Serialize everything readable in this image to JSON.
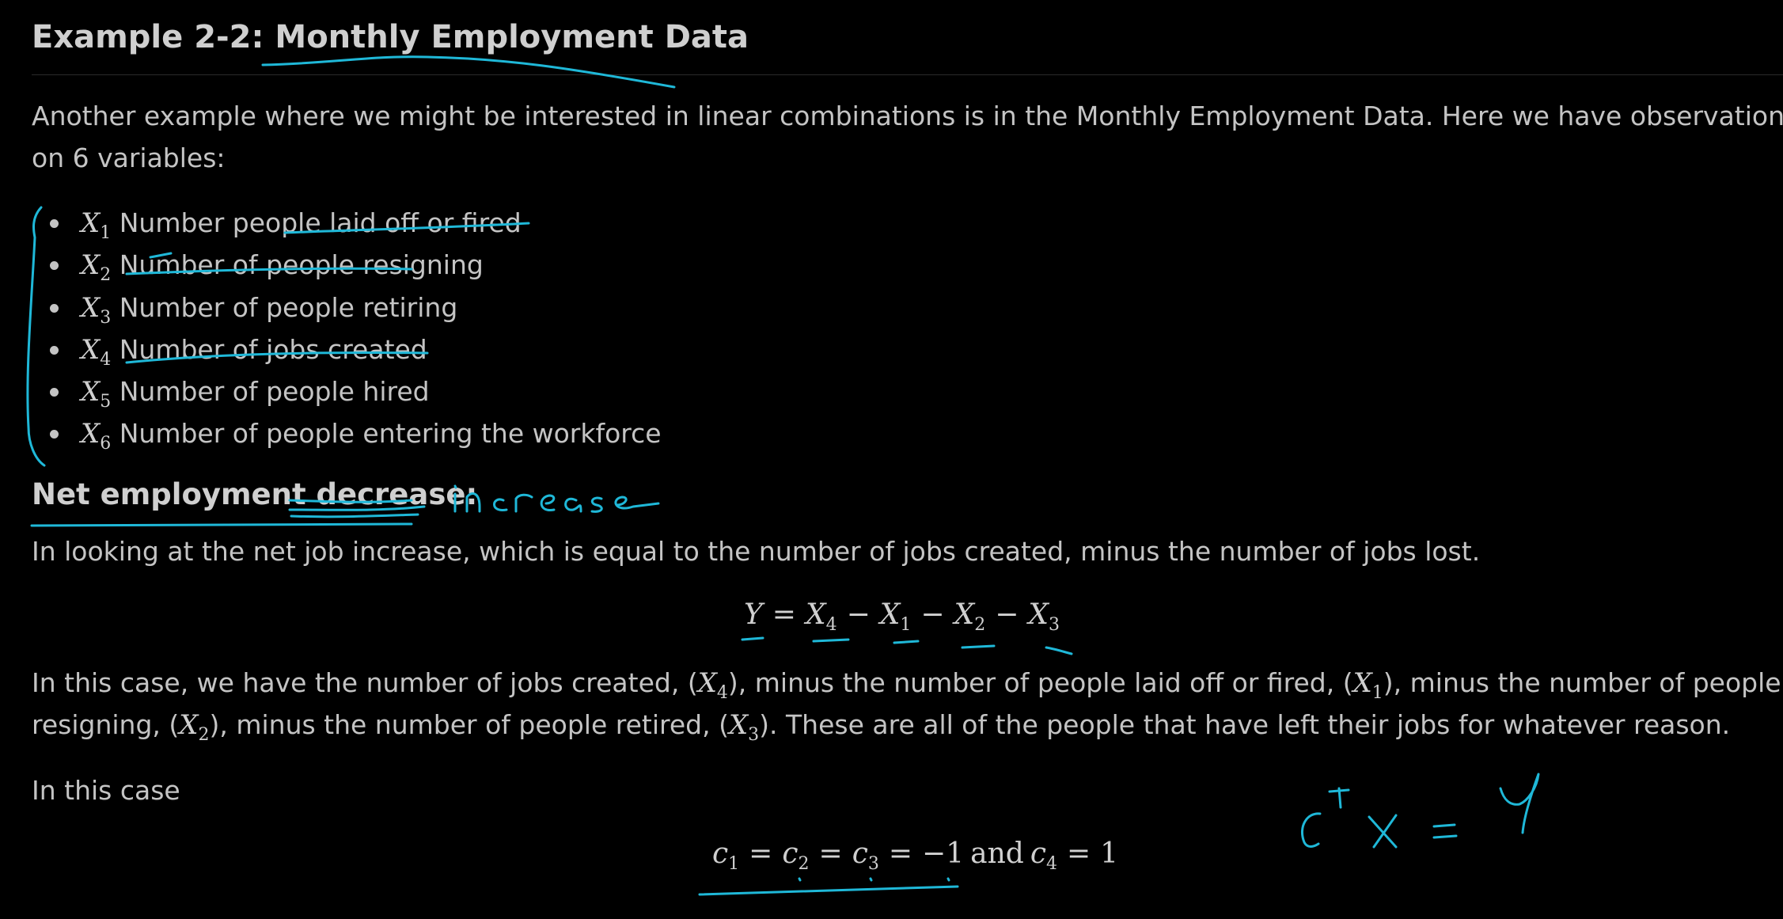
{
  "heading": "Example 2-2: Monthly Employment Data",
  "intro_line1": "Another example where we might be interested in linear combinations is in the Monthly Employment Data. Here we have observations",
  "intro_line2": "on 6 variables:",
  "variables": [
    {
      "symbol": "X",
      "sub": "1",
      "label": "Number people laid off or fired"
    },
    {
      "symbol": "X",
      "sub": "2",
      "label": "Number of people resigning"
    },
    {
      "symbol": "X",
      "sub": "3",
      "label": "Number of people retiring"
    },
    {
      "symbol": "X",
      "sub": "4",
      "label": "Number of jobs created"
    },
    {
      "symbol": "X",
      "sub": "5",
      "label": "Number of people hired"
    },
    {
      "symbol": "X",
      "sub": "6",
      "label": "Number of people entering the workforce"
    }
  ],
  "subheading": {
    "prefix": "Net employment ",
    "crossed_word": "decrease",
    "suffix": ":",
    "handwritten_correction": "increase"
  },
  "net_description": "In looking at the net job increase, which is equal to the number of jobs created, minus the number of jobs lost.",
  "equation1": {
    "lhs": "Y",
    "eq": "=",
    "terms": [
      {
        "sign": "",
        "symbol": "X",
        "sub": "4"
      },
      {
        "sign": "−",
        "symbol": "X",
        "sub": "1"
      },
      {
        "sign": "−",
        "symbol": "X",
        "sub": "2"
      },
      {
        "sign": "−",
        "symbol": "X",
        "sub": "3"
      }
    ]
  },
  "case_paragraph": {
    "line1_a": "In this case, we have the number of jobs created, (",
    "line1_b": "), minus the number of people laid off or fired, (",
    "line1_c": "), minus the number of people",
    "line2_a": "resigning, (",
    "line2_b": "), minus the number of people retired, (",
    "line2_c": "). These are all of the people that have left their jobs for whatever reason."
  },
  "in_this_case": "In this case",
  "equation2": {
    "c1": "c",
    "s1": "1",
    "c2": "c",
    "s2": "2",
    "c3": "c",
    "s3": "3",
    "eq": "=",
    "value_neg": "−1",
    "and": "and",
    "c4": "c",
    "s4": "4",
    "value_pos": "1"
  },
  "handwritten_note": {
    "lhs": "c",
    "sup": "T",
    "x": "x",
    "eq": "=",
    "rhs": "Y"
  },
  "colors": {
    "background": "#000000",
    "text": "#c4c4c4",
    "annotation_ink": "#1fb8d8"
  }
}
